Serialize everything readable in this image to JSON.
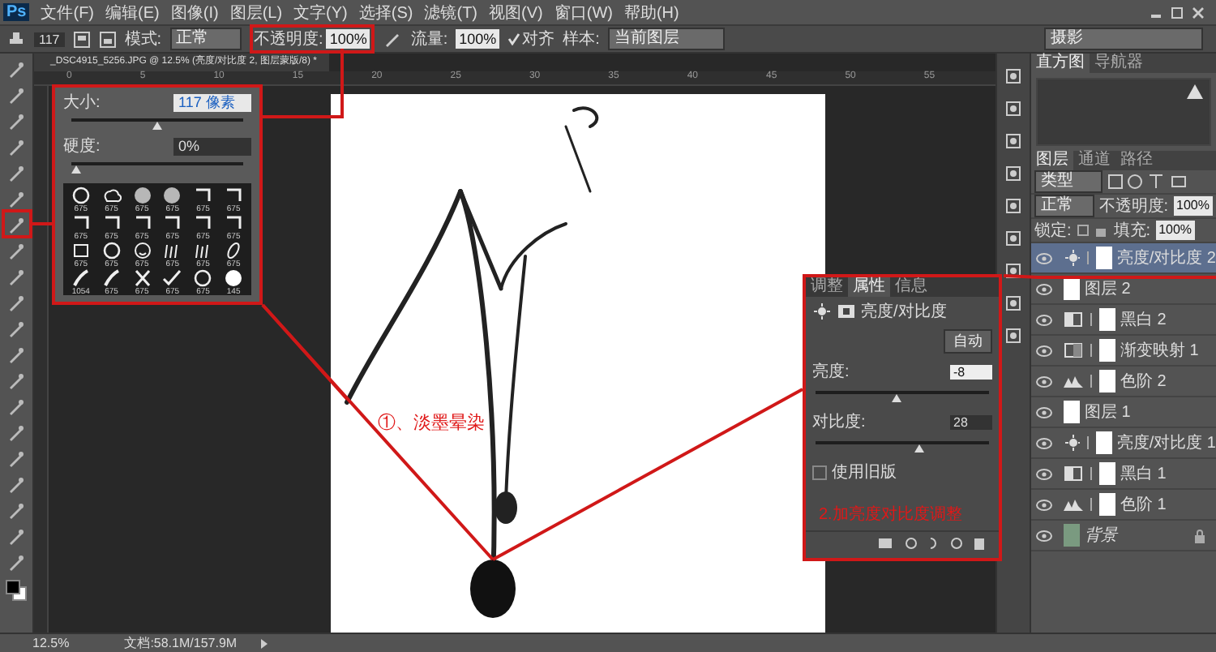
{
  "app": {
    "logo": "Ps"
  },
  "menu": [
    "文件(F)",
    "编辑(E)",
    "图像(I)",
    "图层(L)",
    "文字(Y)",
    "选择(S)",
    "滤镜(T)",
    "视图(V)",
    "窗口(W)",
    "帮助(H)"
  ],
  "options_bar": {
    "brush_size": "117",
    "mode_label": "模式:",
    "mode": "正常",
    "opacity_label": "不透明度:",
    "opacity": "100%",
    "flow_label": "流量:",
    "flow": "100%",
    "align_label": "对齐",
    "align_checked": true,
    "sample_label": "样本:",
    "sample": "当前图层",
    "workspace": "摄影"
  },
  "document_tab": {
    "title": "_DSC4915_5256.JPG @ 12.5% (亮度/对比度 2, 图层蒙版/8) *"
  },
  "ruler": [
    "0",
    "5",
    "10",
    "15",
    "20",
    "25",
    "30",
    "35",
    "40",
    "45",
    "50",
    "55"
  ],
  "brush_picker": {
    "size_label": "大小:",
    "size_value": "117 像素",
    "size_slider": {
      "level": 0.5
    },
    "hardness_label": "硬度:",
    "hardness_value": "0%",
    "hardness_slider": {
      "level": 0
    },
    "presets": [
      {
        "kind": "ring",
        "size": "675"
      },
      {
        "kind": "cloud",
        "size": "675"
      },
      {
        "kind": "soft",
        "size": "675"
      },
      {
        "kind": "soft",
        "size": "675"
      },
      {
        "kind": "corner",
        "size": "675"
      },
      {
        "kind": "corner",
        "size": "675"
      },
      {
        "kind": "corner",
        "size": "675"
      },
      {
        "kind": "corner",
        "size": "675"
      },
      {
        "kind": "corner",
        "size": "675"
      },
      {
        "kind": "corner",
        "size": "675"
      },
      {
        "kind": "corner",
        "size": "675"
      },
      {
        "kind": "corner",
        "size": "675"
      },
      {
        "kind": "frame",
        "size": "675"
      },
      {
        "kind": "ring",
        "size": "675"
      },
      {
        "kind": "face",
        "size": "675"
      },
      {
        "kind": "grass",
        "size": "675"
      },
      {
        "kind": "grass",
        "size": "675"
      },
      {
        "kind": "leaf",
        "size": "675"
      },
      {
        "kind": "stroke",
        "size": "1054"
      },
      {
        "kind": "stroke",
        "size": "675"
      },
      {
        "kind": "cross",
        "size": "675"
      },
      {
        "kind": "check",
        "size": "675"
      },
      {
        "kind": "ring",
        "size": "675"
      },
      {
        "kind": "hard",
        "size": "145"
      }
    ]
  },
  "annotations": {
    "left": "①、淡墨晕染",
    "right": "2.加亮度对比度调整"
  },
  "properties_panel": {
    "tabs": [
      {
        "label": "调整",
        "selected": false
      },
      {
        "label": "属性",
        "selected": true
      },
      {
        "label": "信息",
        "selected": false
      }
    ],
    "title": "亮度/对比度",
    "auto_button": "自动",
    "brightness_label": "亮度:",
    "brightness_value": "-8",
    "brightness_slider": {
      "level": 0.47
    },
    "contrast_label": "对比度:",
    "contrast_value": "28",
    "contrast_slider": {
      "level": 0.6
    },
    "legacy_label": "使用旧版",
    "legacy_checked": false
  },
  "histogram_panel": {
    "tabs": [
      {
        "label": "直方图",
        "selected": true
      },
      {
        "label": "导航器",
        "selected": false
      }
    ]
  },
  "layers_panel": {
    "tabs": [
      {
        "label": "图层",
        "selected": true
      },
      {
        "label": "通道",
        "selected": false
      },
      {
        "label": "路径",
        "selected": false
      }
    ],
    "filter": "类型",
    "blend_mode": "正常",
    "opacity_label": "不透明度:",
    "opacity": "100%",
    "lock_label": "锁定:",
    "fill_label": "填充:",
    "fill": "100%",
    "layers": [
      {
        "name": "亮度/对比度 2",
        "kind": "brightness",
        "selected": true,
        "visible": true,
        "locked": false
      },
      {
        "name": "图层 2",
        "kind": "pixel",
        "selected": false,
        "visible": true,
        "locked": false
      },
      {
        "name": "黑白 2",
        "kind": "bw",
        "selected": false,
        "visible": true,
        "locked": false
      },
      {
        "name": "渐变映射 1",
        "kind": "gradient",
        "selected": false,
        "visible": true,
        "locked": false
      },
      {
        "name": "色阶 2",
        "kind": "levels",
        "selected": false,
        "visible": true,
        "locked": false
      },
      {
        "name": "图层 1",
        "kind": "pixel",
        "selected": false,
        "visible": true,
        "locked": false
      },
      {
        "name": "亮度/对比度 1",
        "kind": "brightness",
        "selected": false,
        "visible": true,
        "locked": false
      },
      {
        "name": "黑白 1",
        "kind": "bw",
        "selected": false,
        "visible": true,
        "locked": false
      },
      {
        "name": "色阶 1",
        "kind": "levels",
        "selected": false,
        "visible": true,
        "locked": false
      },
      {
        "name": "背景",
        "kind": "photo",
        "selected": false,
        "visible": true,
        "locked": true
      }
    ]
  },
  "status_bar": {
    "zoom": "12.5%",
    "doc_info": "文档:58.1M/157.9M"
  }
}
